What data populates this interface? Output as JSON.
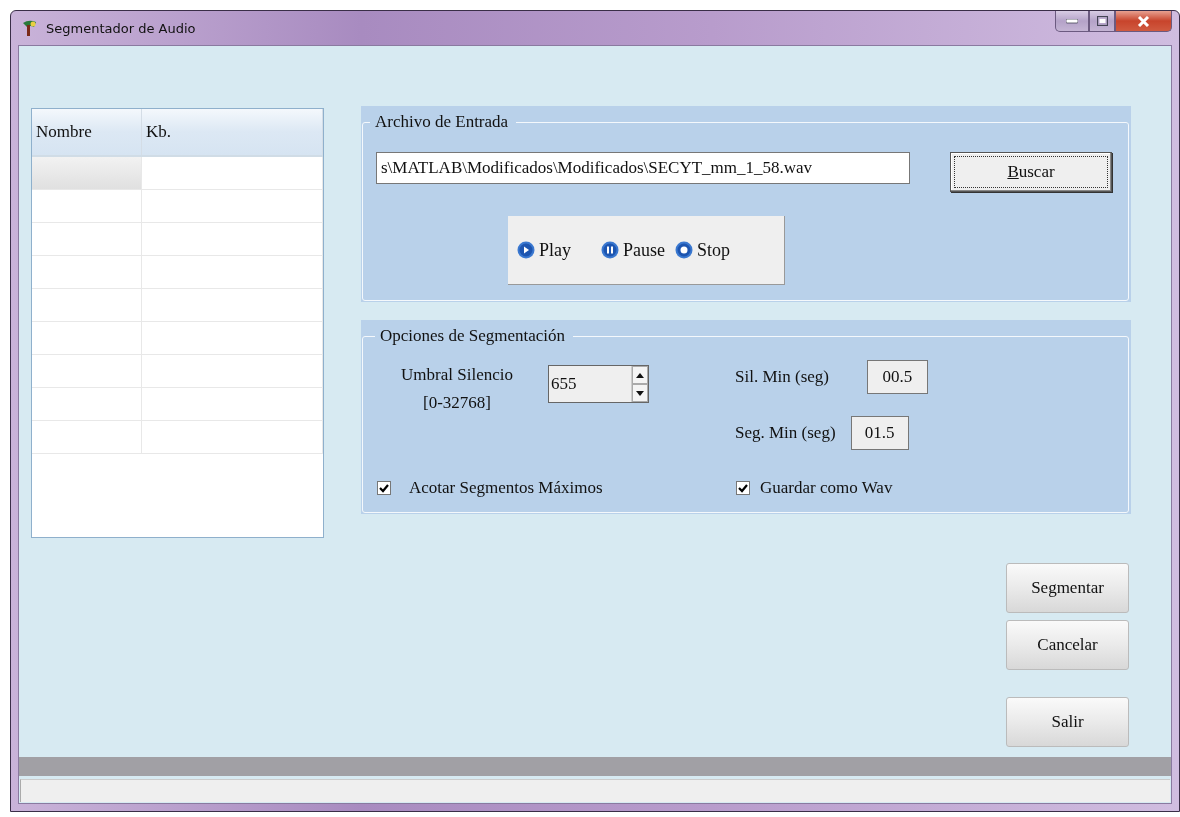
{
  "window": {
    "title": "Segmentador de Audio"
  },
  "file_list": {
    "columns": [
      "Nombre",
      "Kb."
    ],
    "rows": [
      {
        "selected": true
      },
      {
        "selected": false
      },
      {
        "selected": false
      },
      {
        "selected": false
      },
      {
        "selected": false
      },
      {
        "selected": false
      },
      {
        "selected": false
      },
      {
        "selected": false
      },
      {
        "selected": false
      }
    ]
  },
  "input_group": {
    "title": "Archivo de Entrada",
    "file_path": "s\\MATLAB\\Modificados\\Modificados\\SECYT_mm_1_58.wav",
    "browse_button": {
      "label": "Buscar",
      "underline_first": true
    },
    "playback": [
      {
        "kind": "play",
        "label": "Play"
      },
      {
        "kind": "pause",
        "label": "Pause"
      },
      {
        "kind": "stop",
        "label": "Stop"
      }
    ]
  },
  "options_group": {
    "title": "Opciones de Segmentación",
    "threshold_label": "Umbral Silencio",
    "threshold_range": "[0-32768]",
    "threshold_value": "655",
    "min_silence_label": "Sil. Min (seg)",
    "min_silence_value": "00.5",
    "min_segment_label": "Seg. Min (seg)",
    "min_segment_value": "01.5",
    "checkboxes": [
      {
        "label": "Acotar Segmentos Máximos",
        "checked": true
      },
      {
        "label": "Guardar como Wav",
        "checked": true
      }
    ]
  },
  "actions": [
    "Segmentar",
    "Cancelar",
    "Salir"
  ]
}
